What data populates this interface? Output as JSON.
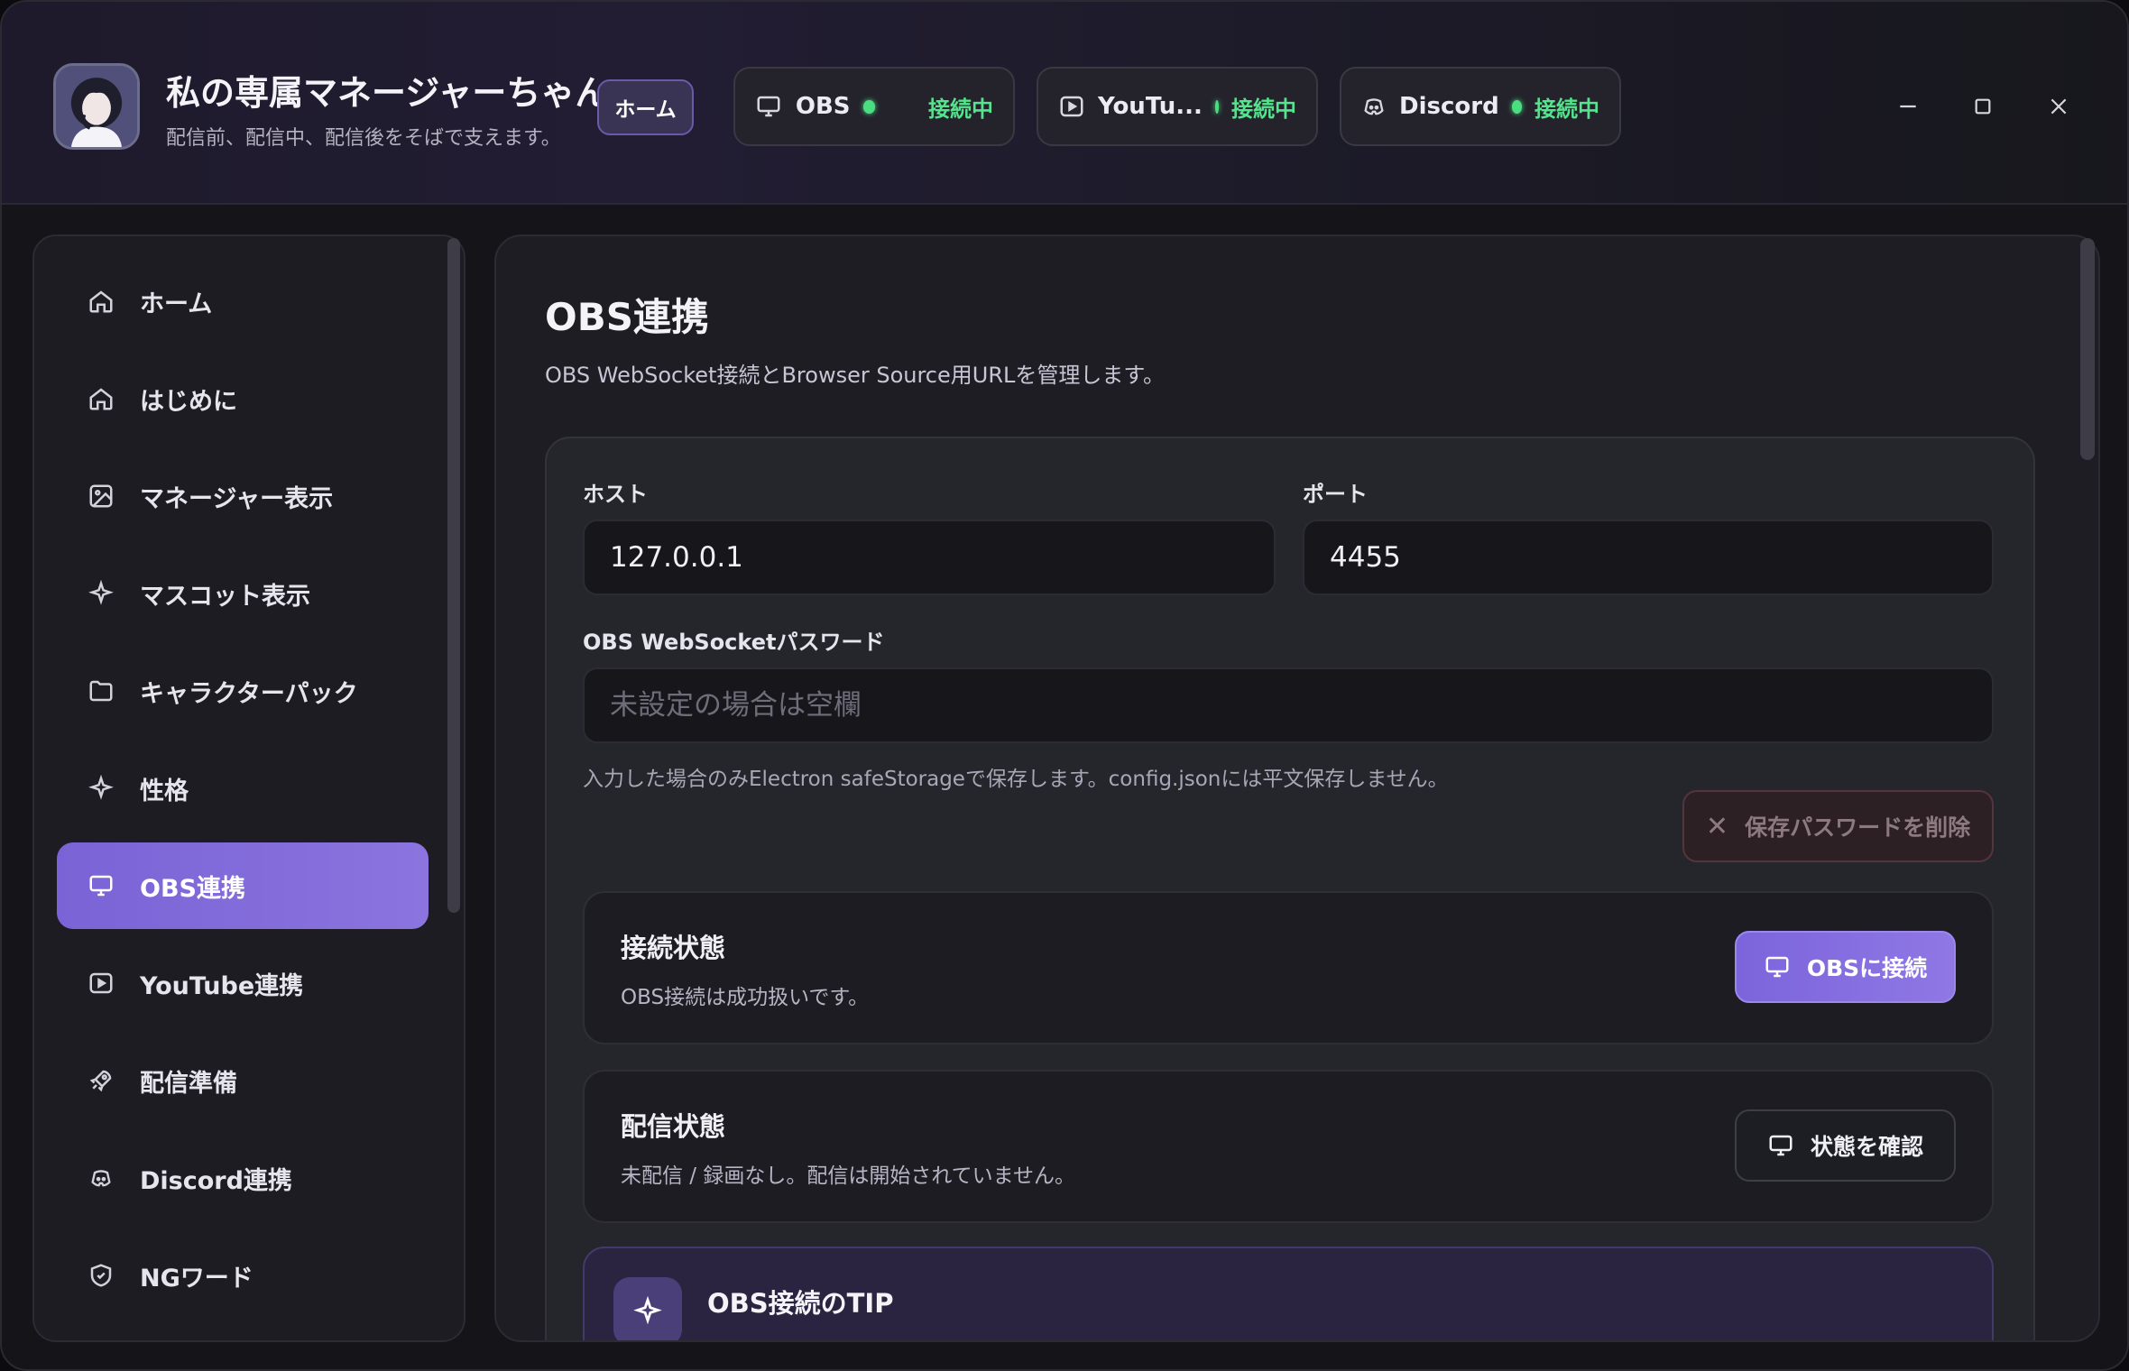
{
  "app": {
    "title": "私の専属マネージャーちゃん",
    "subtitle": "配信前、配信中、配信後をそばで支えます。",
    "home_chip": "ホーム"
  },
  "status": [
    {
      "name": "OBS",
      "state": "接続中",
      "icon": "monitor-icon",
      "color": "#4ade80"
    },
    {
      "name": "YouTu...",
      "state": "接続中",
      "icon": "play-icon",
      "color": "#4ade80"
    },
    {
      "name": "Discord",
      "state": "接続中",
      "icon": "discord-icon",
      "color": "#4ade80"
    }
  ],
  "window_controls": {
    "minimize": "minimize-icon",
    "maximize": "maximize-icon",
    "close": "close-icon"
  },
  "sidebar": {
    "items": [
      {
        "label": "ホーム",
        "icon": "home-icon"
      },
      {
        "label": "はじめに",
        "icon": "home-icon"
      },
      {
        "label": "マネージャー表示",
        "icon": "image-icon"
      },
      {
        "label": "マスコット表示",
        "icon": "sparkle-icon"
      },
      {
        "label": "キャラクターパック",
        "icon": "folder-icon"
      },
      {
        "label": "性格",
        "icon": "sparkle-icon"
      },
      {
        "label": "OBS連携",
        "icon": "monitor-icon",
        "active": true
      },
      {
        "label": "YouTube連携",
        "icon": "play-icon"
      },
      {
        "label": "配信準備",
        "icon": "rocket-icon"
      },
      {
        "label": "Discord連携",
        "icon": "discord-icon"
      },
      {
        "label": "NGワード",
        "icon": "shield-icon"
      }
    ]
  },
  "main": {
    "title": "OBS連携",
    "description": "OBS WebSocket接続とBrowser Source用URLを管理します。",
    "host_label": "ホスト",
    "host_value": "127.0.0.1",
    "port_label": "ポート",
    "port_value": "4455",
    "password_label": "OBS WebSocketパスワード",
    "password_placeholder": "未設定の場合は空欄",
    "password_hint": "入力した場合のみElectron safeStorageで保存します。config.jsonには平文保存しません。",
    "delete_password_label": "保存パスワードを削除",
    "connection": {
      "title": "接続状態",
      "desc": "OBS接続は成功扱いです。",
      "button": "OBSに接続"
    },
    "stream": {
      "title": "配信状態",
      "desc": "未配信 / 録画なし。配信は開始されていません。",
      "button": "状態を確認"
    },
    "tip": {
      "title": "OBS接続のTIP"
    }
  },
  "colors": {
    "accent": "#7c64dc",
    "status_ok": "#4ade80"
  }
}
